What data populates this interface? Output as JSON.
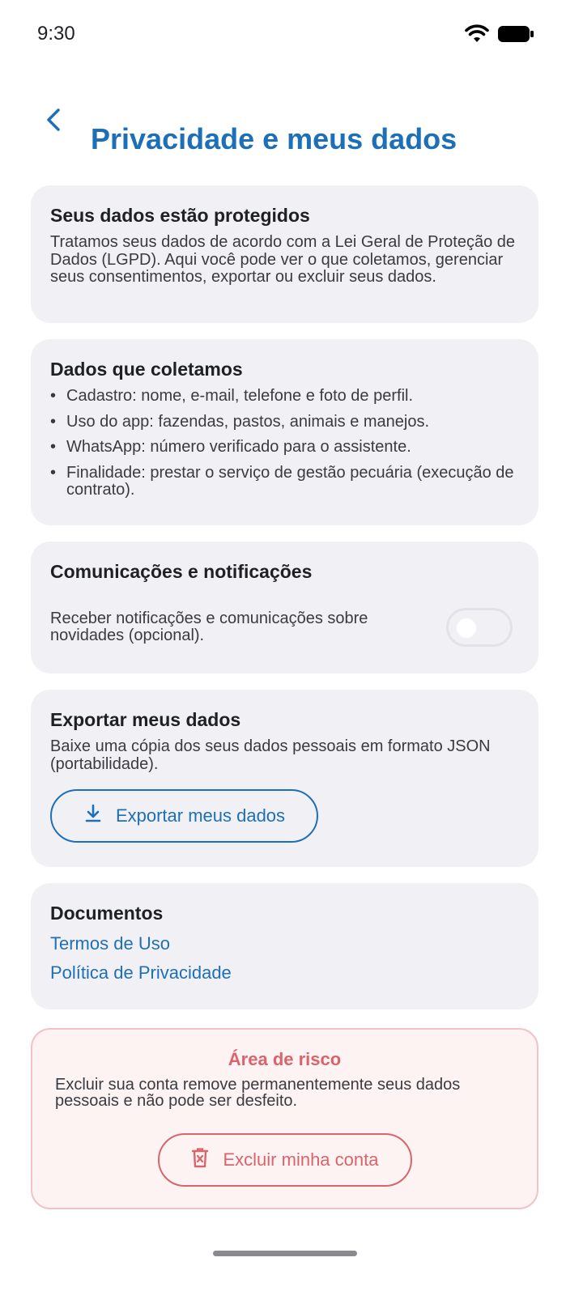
{
  "status_bar": {
    "time": "9:30"
  },
  "header": {
    "title": "Privacidade e meus dados",
    "back_icon": "chevron-left-icon"
  },
  "protected": {
    "title": "Seus dados estão protegidos",
    "text": "Tratamos seus dados de acordo com a Lei Geral de Proteção de Dados (LGPD). Aqui você pode ver o que coletamos, gerenciar seus consentimentos, exportar ou excluir seus dados."
  },
  "collected": {
    "title": "Dados que coletamos",
    "items": [
      "Cadastro: nome, e-mail, telefone e foto de perfil.",
      "Uso do app: fazendas, pastos, animais e manejos.",
      "WhatsApp: número verificado para o assistente.",
      "Finalidade: prestar o serviço de gestão pecuária (execução de contrato)."
    ]
  },
  "notifications": {
    "title": "Comunicações e notificações",
    "text": "Receber notificações e comunicações sobre novidades (opcional).",
    "enabled": false
  },
  "export": {
    "title": "Exportar meus dados",
    "text": "Baixe uma cópia dos seus dados pessoais em formato JSON (portabilidade).",
    "button_label": "Exportar meus dados",
    "button_icon": "download-icon"
  },
  "documents": {
    "title": "Documentos",
    "terms_label": "Termos de Uso",
    "privacy_label": "Política de Privacidade"
  },
  "risk": {
    "title": "Área de risco",
    "text": "Excluir sua conta remove permanentemente seus dados pessoais e não pode ser desfeito.",
    "button_label": "Excluir minha conta",
    "button_icon": "trash-icon"
  },
  "colors": {
    "accent": "#1d6fb8",
    "danger": "#d9646b",
    "card_background": "#f1f1f5",
    "danger_background": "#fdf3f3"
  }
}
